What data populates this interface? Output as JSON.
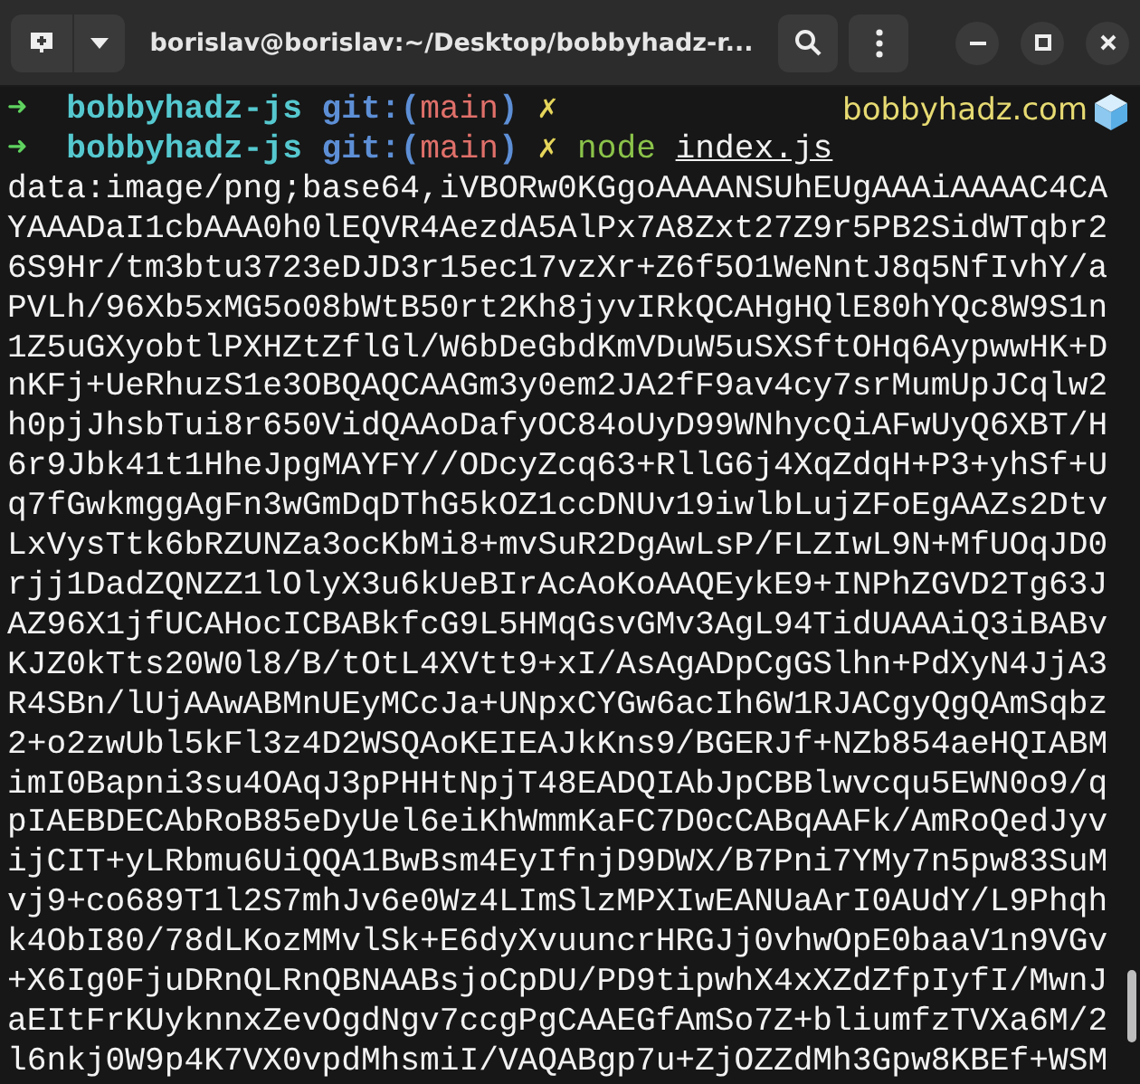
{
  "window": {
    "title": "borislav@borislav:~/Desktop/bobbyhadz-r..."
  },
  "prompts": [
    {
      "arrow": "➜",
      "directory": "bobbyhadz-js",
      "git_open": "git:(",
      "branch": "main",
      "git_close": ")",
      "dirty_mark": "✗",
      "right_text": "bobbyhadz.com"
    },
    {
      "arrow": "➜",
      "directory": "bobbyhadz-js",
      "git_open": "git:(",
      "branch": "main",
      "git_close": ")",
      "dirty_mark": "✗",
      "command": "node",
      "argument": "index.js"
    }
  ],
  "output_lines": [
    "data:image/png;base64,iVBORw0KGgoAAAANSUhEUgAAAiAAAAC4CA",
    "YAAADaI1cbAAA0h0lEQVR4AezdA5AlPx7A8Zxt27Z9r5PB2SidWTqbr2",
    "6S9Hr/tm3btu3723eDJD3r15ec17vzXr+Z6f5O1WeNntJ8q5NfIvhY/a",
    "PVLh/96Xb5xMG5o08bWtB50rt2Kh8jyvIRkQCAHgHQlE80hYQc8W9S1n",
    "1Z5uGXyobtlPXHZtZflGl/W6bDeGbdKmVDuW5uSXSftOHq6AypwwHK+D",
    "nKFj+UeRhuzS1e3OBQAQCAAGm3y0em2JA2fF9av4cy7srMumUpJCqlw2",
    "h0pjJhsbTui8r650VidQAAoDafyOC84oUyD99WNhycQiAFwUyQ6XBT/H",
    "6r9Jbk41t1HheJpgMAYFY//ODcyZcq63+RllG6j4XqZdqH+P3+yhSf+U",
    "q7fGwkmggAgFn3wGmDqDThG5kOZ1ccDNUv19iwlbLujZFoEgAAZs2Dtv",
    "LxVysTtk6bRZUNZa3ocKbMi8+mvSuR2DgAwLsP/FLZIwL9N+MfUOqJD0",
    "rjj1DadZQNZZ1lOlyX3u6kUeBIrAcAoKoAAQEykE9+INPhZGVD2Tg63J",
    "AZ96X1jfUCAHocICBABkfcG9L5HMqGsvGMv3AgL94TidUAAAiQ3iBABv",
    "KJZ0kTts20W0l8/B/tOtL4XVtt9+xI/AsAgADpCgGSlhn+PdXyN4JjA3",
    "R4SBn/lUjAAwABMnUEyMCcJa+UNpxCYGw6acIh6W1RJACgyQgQAmSqbz",
    "2+o2zwUbl5kFl3z4D2WSQAoKEIEAJkKns9/BGERJf+NZb854aeHQIABM",
    "imI0Bapni3su4OAqJ3pPHHtNpjT48EADQIAbJpCBBlwvcqu5EWN0o9/q",
    "pIAEBDECAbRoB85eDyUel6eiKhWmmKaFC7D0cCABqAAFk/AmRoQedJyv",
    "ijCIT+yLRbmu6UiQQA1BwBsm4EyIfnjD9DWX/B7Pni7YMy7n5pw83SuM",
    "vj9+co689T1l2S7mhJv6e0Wz4LImSlzMPXIwEANUaArI0AUdY/L9Phqh",
    "k4ObI80/78dLKozMMvlSk+E6dyXvuuncrHRGJj0vhwOpE0baaV1n9VGv",
    "+X6Ig0FjuDRnQLRnQBNAABsjoCpDU/PD9tipwhX4xXZdZfpIyfI/MwnJ",
    "aEItFrKUyknnxZevOgdNgv7ccgPgCAAEGfAmSo7Z+bliumfzTVXa6M/2",
    "l6nkj0W9p4K7VX0vpdMhsmiI/VAQABgp7u+ZjOZZdMh3Gpw8KBEf+WSM"
  ]
}
